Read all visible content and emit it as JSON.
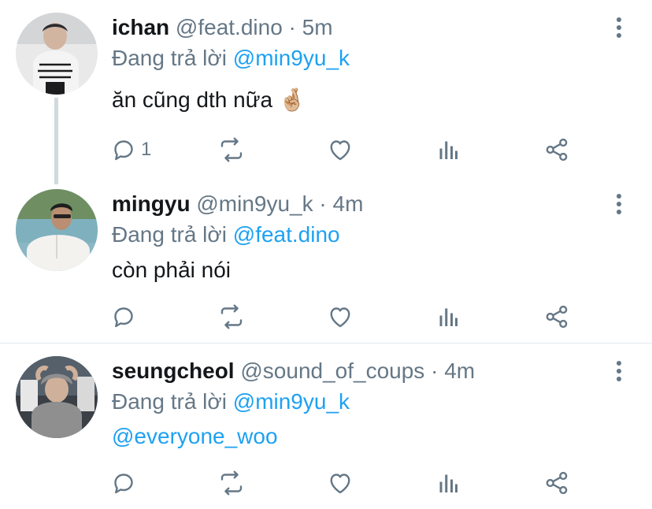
{
  "tweets": [
    {
      "name": "ichan",
      "handle": "@feat.dino",
      "separator": "·",
      "time": "5m",
      "reply_prefix": "Đang trả lời",
      "reply_to": "@min9yu_k",
      "text": "ăn cũng dth nữa 🤞🏼",
      "reply_count": "1",
      "avatar_icon": "avatar-photo"
    },
    {
      "name": "mingyu",
      "handle": "@min9yu_k",
      "separator": "·",
      "time": "4m",
      "reply_prefix": "Đang trả lời",
      "reply_to": "@feat.dino",
      "text": "còn phải nói",
      "reply_count": "",
      "avatar_icon": "avatar-photo"
    },
    {
      "name": "seungcheol",
      "handle": "@sound_of_coups",
      "separator": "·",
      "time": "4m",
      "reply_prefix": "Đang trả lời",
      "reply_to": "@min9yu_k",
      "text": "@everyone_woo",
      "reply_count": "",
      "avatar_icon": "avatar-photo"
    }
  ],
  "colors": {
    "accent": "#1da1f2",
    "muted": "#657786",
    "text": "#14171a",
    "thread_line": "#cfd9de",
    "divider": "#e1e8ed"
  },
  "icons": [
    "reply-icon",
    "retweet-icon",
    "like-icon",
    "analytics-icon",
    "share-icon",
    "more-options-icon"
  ]
}
